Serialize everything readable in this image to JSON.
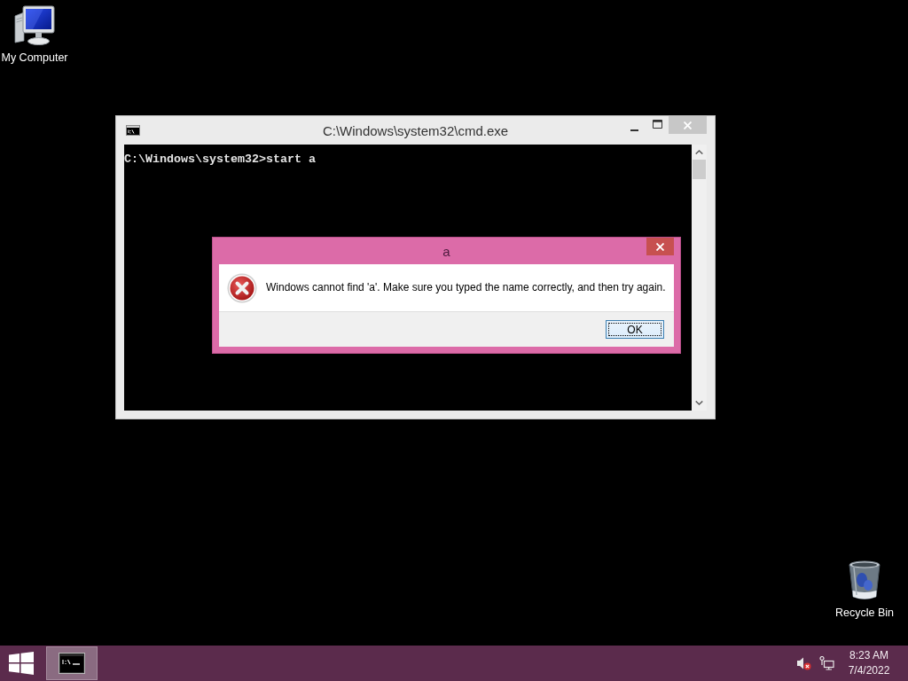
{
  "desktop": {
    "icons": [
      {
        "kind": "computer",
        "label": "My Computer"
      },
      {
        "kind": "recycle-bin",
        "label": "Recycle Bin"
      }
    ]
  },
  "windows": [
    {
      "kind": "console",
      "active": false,
      "title": "C:\\Windows\\system32\\cmd.exe",
      "lines": [
        "C:\\Windows\\system32>start a"
      ]
    },
    {
      "kind": "message",
      "active": true,
      "title": "a",
      "message": "Windows cannot find 'a'. Make sure you typed the name correctly, and then try again.",
      "buttons": [
        {
          "label": "OK",
          "focused": true
        }
      ]
    }
  ],
  "taskbar": {
    "apps": [
      {
        "kind": "console",
        "selected": true
      }
    ],
    "tray": [
      {
        "kind": "volume",
        "muted": true
      },
      {
        "kind": "network"
      }
    ],
    "clock": {
      "time": "8:23 AM",
      "date": "7/4/2022"
    }
  }
}
